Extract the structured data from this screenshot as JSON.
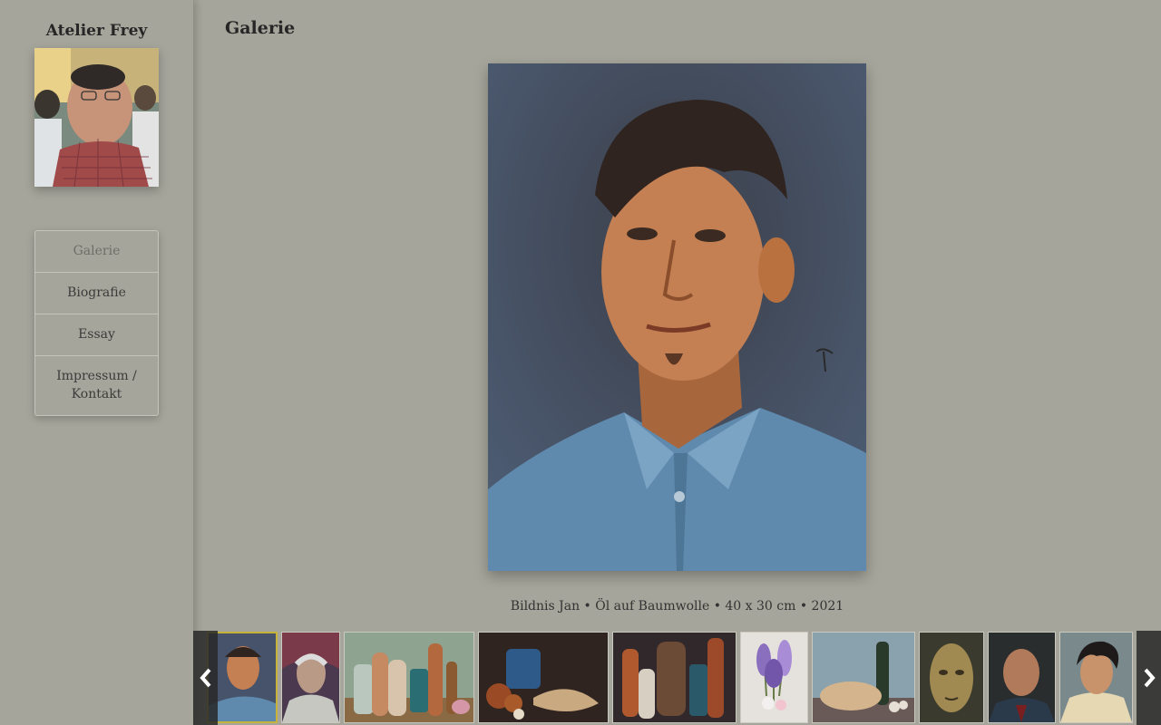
{
  "sidebar": {
    "site_title": "Atelier Frey",
    "avatar_alt": "Porträt des Künstlers",
    "nav": [
      {
        "label": "Galerie",
        "active": true
      },
      {
        "label": "Biografie",
        "active": false
      },
      {
        "label": "Essay",
        "active": false
      },
      {
        "label": "Impressum / Kontakt",
        "active": false
      }
    ]
  },
  "main": {
    "title": "Galerie",
    "painting": {
      "caption": "Bildnis Jan • Öl auf Baumwolle • 40 x 30 cm • 2021"
    }
  },
  "thumbnails": {
    "prev_icon": "chevron-left-icon",
    "next_icon": "chevron-right-icon",
    "items": [
      {
        "subject": "portrait-young-man",
        "active": true
      },
      {
        "subject": "portrait-old-man"
      },
      {
        "subject": "still-life-bottles"
      },
      {
        "subject": "still-life-fish-onions"
      },
      {
        "subject": "still-life-jugs"
      },
      {
        "subject": "flowers-lilac"
      },
      {
        "subject": "still-life-bread-wine"
      },
      {
        "subject": "portrait-sculpted-head"
      },
      {
        "subject": "portrait-bald-man"
      },
      {
        "subject": "portrait-dark-hair"
      }
    ]
  },
  "colors": {
    "background": "#a5a59b",
    "active_thumb_border": "#c7b23a",
    "nav_active_text": "#6e6e68"
  }
}
